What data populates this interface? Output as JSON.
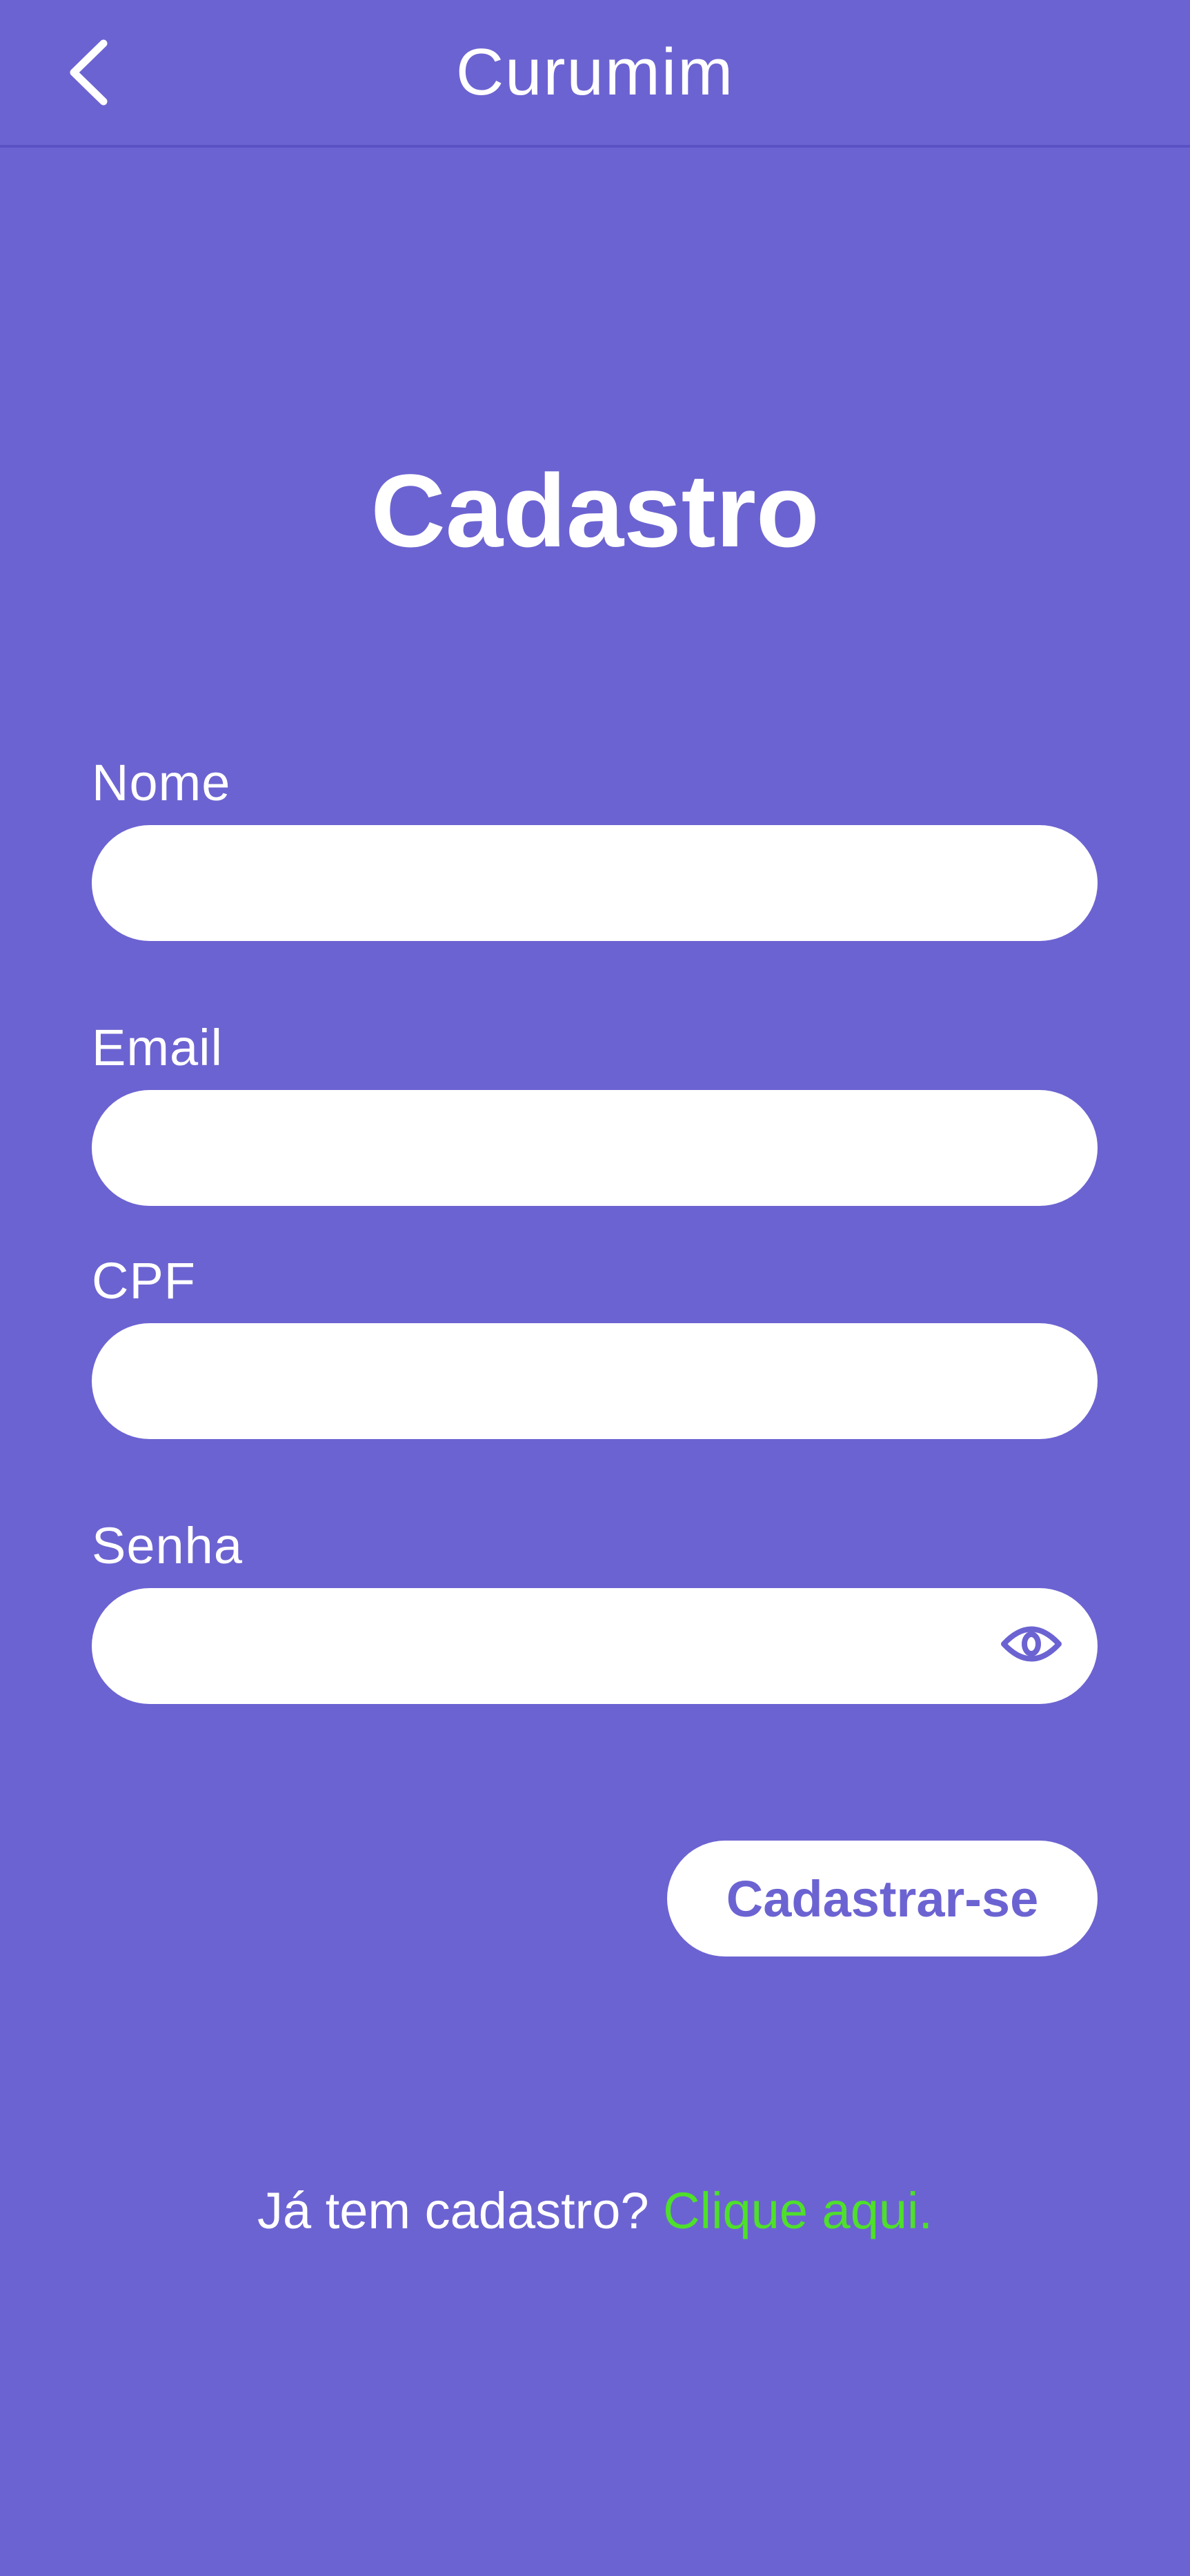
{
  "header": {
    "back_icon": "chevron-left-icon",
    "title": "Curumim"
  },
  "main": {
    "title": "Cadastro",
    "fields": {
      "nome": {
        "label": "Nome",
        "value": ""
      },
      "email": {
        "label": "Email",
        "value": ""
      },
      "cpf": {
        "label": "CPF",
        "value": ""
      },
      "senha": {
        "label": "Senha",
        "value": "",
        "toggle_icon": "eye-icon"
      }
    },
    "submit_label": "Cadastrar-se"
  },
  "footer": {
    "prompt": "Já tem cadastro?",
    "link": "Clique aqui."
  },
  "colors": {
    "background": "#6c63d2",
    "input_background": "#ffffff",
    "button_text": "#6c63d2",
    "link": "#4ee02a"
  }
}
